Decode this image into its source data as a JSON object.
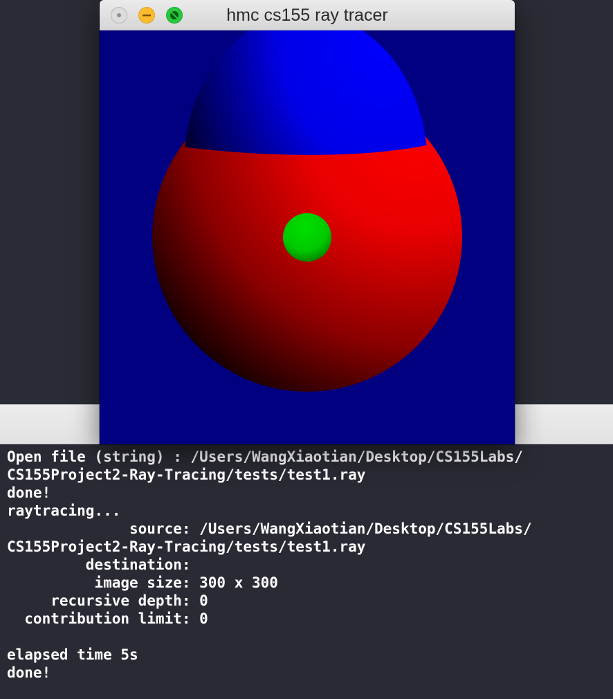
{
  "window": {
    "title": "hmc cs155 ray tracer"
  },
  "render": {
    "background_color": "#000080",
    "objects": [
      {
        "name": "blue sphere",
        "color": "#0000ff"
      },
      {
        "name": "red sphere",
        "color": "#ff0000"
      },
      {
        "name": "green sphere",
        "color": "#00d000"
      }
    ]
  },
  "console": {
    "lines": [
      "Open file (string) : /Users/WangXiaotian/Desktop/CS155Labs/",
      "CS155Project2-Ray-Tracing/tests/test1.ray",
      "done!",
      "raytracing...",
      "              source: /Users/WangXiaotian/Desktop/CS155Labs/",
      "CS155Project2-Ray-Tracing/tests/test1.ray",
      "         destination:",
      "          image size: 300 x 300",
      "     recursive depth: 0",
      "  contribution limit: 0",
      "",
      "elapsed time 5s",
      "done!"
    ]
  }
}
